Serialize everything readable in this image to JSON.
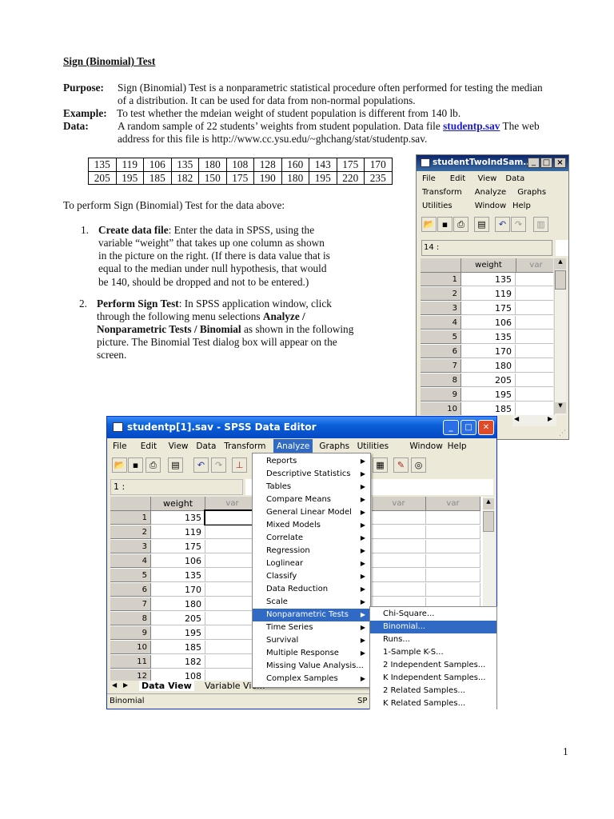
{
  "doc": {
    "title": "Sign (Binomial) Test",
    "purpose_label": "Purpose",
    "purpose_l1": "Sign (Binomial) Test is a nonparametric statistical procedure often performed for testing the median",
    "purpose_l2": "of a distribution. It can be used for data from non-normal populations.",
    "example_label": "Example",
    "example_text": "To test whether the mdeian weight of student population is different from 140 lb.",
    "data_label": "Data",
    "data_l1a": "A random sample of 22 students’ weights from student population. Data file ",
    "data_link": "studentp.sav",
    "data_l1b": " The web",
    "data_l2": "address for this file is http://www.cc.ysu.edu/~ghchang/stat/studentp.sav.",
    "table": [
      [
        "135",
        "119",
        "106",
        "135",
        "180",
        "108",
        "128",
        "160",
        "143",
        "175",
        "170"
      ],
      [
        "205",
        "195",
        "185",
        "182",
        "150",
        "175",
        "190",
        "180",
        "195",
        "220",
        "235"
      ]
    ],
    "intro": "To perform Sign (Binomial) Test for the data above:",
    "step1_num": "1.",
    "step1_bold": "Create data file",
    "step1_l1": ": Enter the data in SPSS, using the",
    "step1_l2": "variable “weight” that takes up one column as shown",
    "step1_l3": "in the picture on the right. (If there is data value that is",
    "step1_l4": "equal to the median under null hypothesis, that would",
    "step1_l5": "be 140, should be dropped and not to be entered.)",
    "step2_num": "2.",
    "step2_bold": "Perform Sign Test",
    "step2_l1": ": In SPSS application window, click",
    "step2_l2": "through the following menu selections ",
    "step2_l2b": "Analyze /",
    "step2_l3b": "Nonparametric Tests / Binomial",
    "step2_l3": "  as shown in the following",
    "step2_l4": "picture. The Binomial Test dialog box will appear on the",
    "step2_l5": "screen.",
    "page_number": "1"
  },
  "small_window": {
    "title": "studentTwoIndSam...",
    "menu_rows": [
      [
        "File",
        "Edit",
        "View",
        "Data"
      ],
      [
        "Transform",
        "Analyze",
        "Graphs"
      ],
      [
        "Utilities",
        "Window",
        "Help"
      ]
    ],
    "cell_ref": "14 :",
    "col_header": "weight",
    "var_header": "var",
    "rows": [
      [
        "1",
        "135"
      ],
      [
        "2",
        "119"
      ],
      [
        "3",
        "175"
      ],
      [
        "4",
        "106"
      ],
      [
        "5",
        "135"
      ],
      [
        "6",
        "170"
      ],
      [
        "7",
        "180"
      ],
      [
        "8",
        "205"
      ],
      [
        "9",
        "195"
      ],
      [
        "10",
        "185"
      ]
    ]
  },
  "large_window": {
    "title": "studentp[1].sav - SPSS Data Editor",
    "menu": [
      "File",
      "Edit",
      "View",
      "Data",
      "Transform",
      "Analyze",
      "Graphs",
      "Utilities",
      "Window",
      "Help"
    ],
    "cell_ref": "1 :",
    "col_header": "weight",
    "var_header": "var",
    "rows": [
      [
        "1",
        "135"
      ],
      [
        "2",
        "119"
      ],
      [
        "3",
        "175"
      ],
      [
        "4",
        "106"
      ],
      [
        "5",
        "135"
      ],
      [
        "6",
        "170"
      ],
      [
        "7",
        "180"
      ],
      [
        "8",
        "205"
      ],
      [
        "9",
        "195"
      ],
      [
        "10",
        "185"
      ],
      [
        "11",
        "182"
      ],
      [
        "12",
        "108"
      ]
    ],
    "tab_data_view": "Data View",
    "tab_variable_view": "Variable Vie...",
    "status": "Binomial",
    "status_right": "SP",
    "analyze_menu": [
      "Reports",
      "Descriptive Statistics",
      "Tables",
      "Compare Means",
      "General Linear Model",
      "Mixed Models",
      "Correlate",
      "Regression",
      "Loglinear",
      "Classify",
      "Data Reduction",
      "Scale",
      "Nonparametric Tests",
      "Time Series",
      "Survival",
      "Multiple Response",
      "Missing Value Analysis...",
      "Complex Samples"
    ],
    "analyze_has_arrow": [
      true,
      true,
      true,
      true,
      true,
      true,
      true,
      true,
      true,
      true,
      true,
      true,
      true,
      true,
      true,
      true,
      false,
      true
    ],
    "analyze_selected": "Nonparametric Tests",
    "nonparam_menu": [
      "Chi-Square...",
      "Binomial...",
      "Runs...",
      "1-Sample K-S...",
      "2 Independent Samples...",
      "K Independent Samples...",
      "2 Related Samples...",
      "K Related Samples..."
    ],
    "nonparam_selected": "Binomial..."
  },
  "colors": {
    "xp_blue": "#0a5fd8",
    "highlight": "#316ac5",
    "link": "#1a1ad0"
  }
}
